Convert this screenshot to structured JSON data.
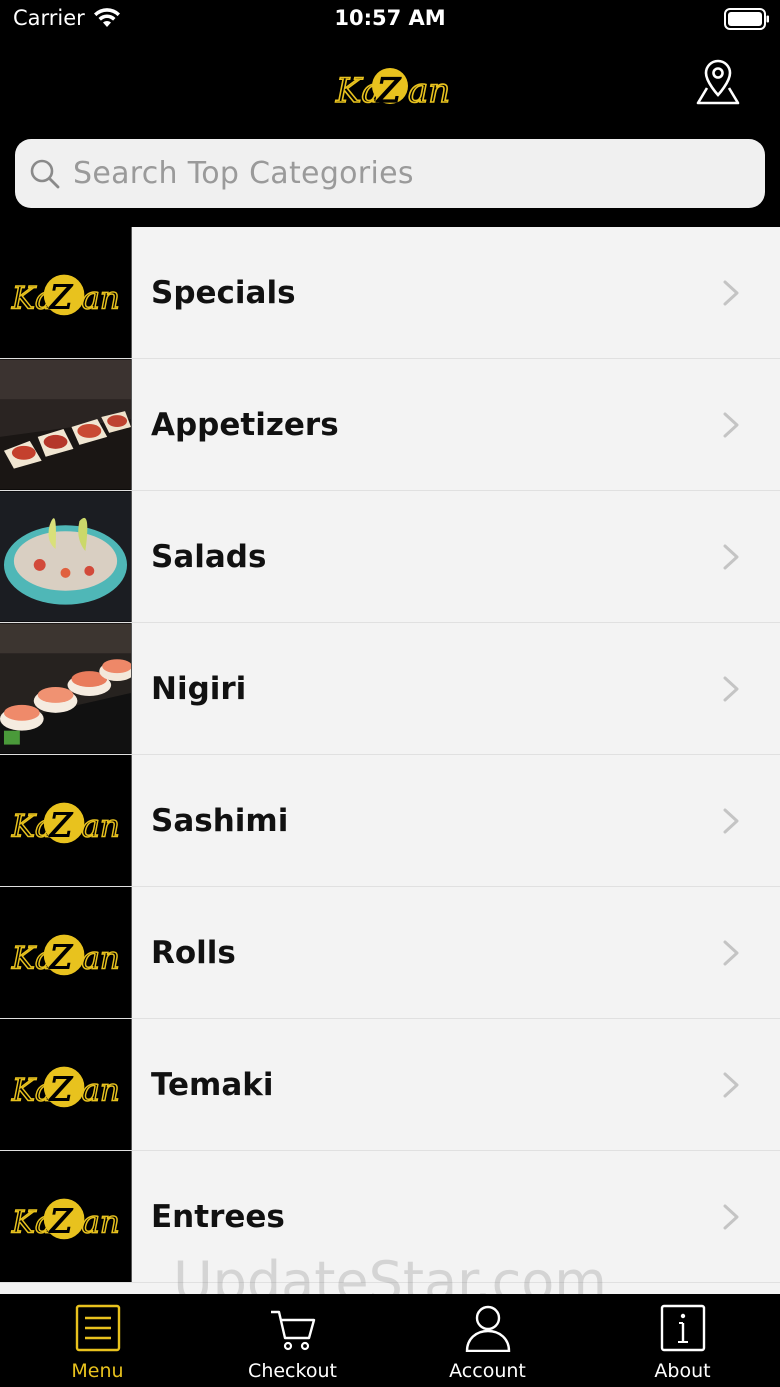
{
  "status_bar": {
    "carrier": "Carrier",
    "time": "10:57 AM"
  },
  "header": {
    "logo_text": "KaiZan",
    "location_icon": "map-pin-icon"
  },
  "search": {
    "placeholder": "Search Top Categories"
  },
  "categories": [
    {
      "label": "Specials",
      "thumb": "logo"
    },
    {
      "label": "Appetizers",
      "thumb": "photo-appetizers"
    },
    {
      "label": "Salads",
      "thumb": "photo-salads"
    },
    {
      "label": "Nigiri",
      "thumb": "photo-nigiri"
    },
    {
      "label": "Sashimi",
      "thumb": "logo"
    },
    {
      "label": "Rolls",
      "thumb": "logo"
    },
    {
      "label": "Temaki",
      "thumb": "logo"
    },
    {
      "label": "Entrees",
      "thumb": "logo"
    }
  ],
  "watermark": "UpdateStar.com",
  "tabs": [
    {
      "label": "Menu",
      "icon": "menu-list-icon",
      "active": true
    },
    {
      "label": "Checkout",
      "icon": "cart-icon",
      "active": false
    },
    {
      "label": "Account",
      "icon": "person-icon",
      "active": false
    },
    {
      "label": "About",
      "icon": "info-icon",
      "active": false
    }
  ],
  "colors": {
    "accent": "#e8c21e",
    "background": "#000000",
    "list_background": "#f3f3f3"
  }
}
